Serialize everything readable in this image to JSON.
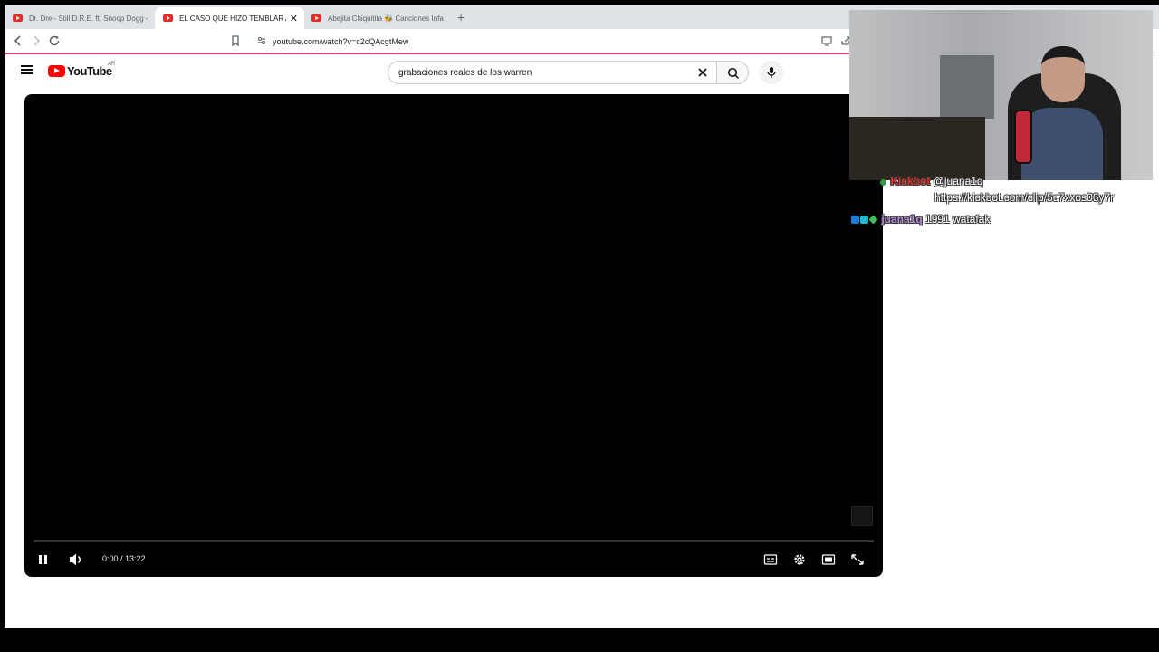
{
  "browser": {
    "tabs": [
      {
        "title": "Dr. Dre - Still D.R.E. ft. Snoop Dogg -",
        "active": false
      },
      {
        "title": "EL CASO QUE HIZO TEMBLAR A",
        "active": true,
        "close": "✕"
      },
      {
        "title": "Abejita Chiquitita 🐝 Canciones Infa",
        "active": false
      }
    ],
    "new_tab": "+",
    "url": "youtube.com/watch?v=c2cQAcgtMew"
  },
  "youtube": {
    "logo_text": "YouTube",
    "country_code": "AR",
    "search_value": "grabaciones reales de los warren",
    "accent_color": "#ff0000"
  },
  "player": {
    "time": "0:00 / 13:22",
    "progress": 0.0
  },
  "chat": [
    {
      "user": "Kickbot",
      "message": "@juana1q",
      "user_color": "#d9322b"
    },
    {
      "user": "",
      "message": "https://kickbot.com/clip/5c7xxos06y7r",
      "user_color": ""
    },
    {
      "user": "juana1q",
      "message": "1991 watafak",
      "user_color": "#b38bd6"
    }
  ]
}
